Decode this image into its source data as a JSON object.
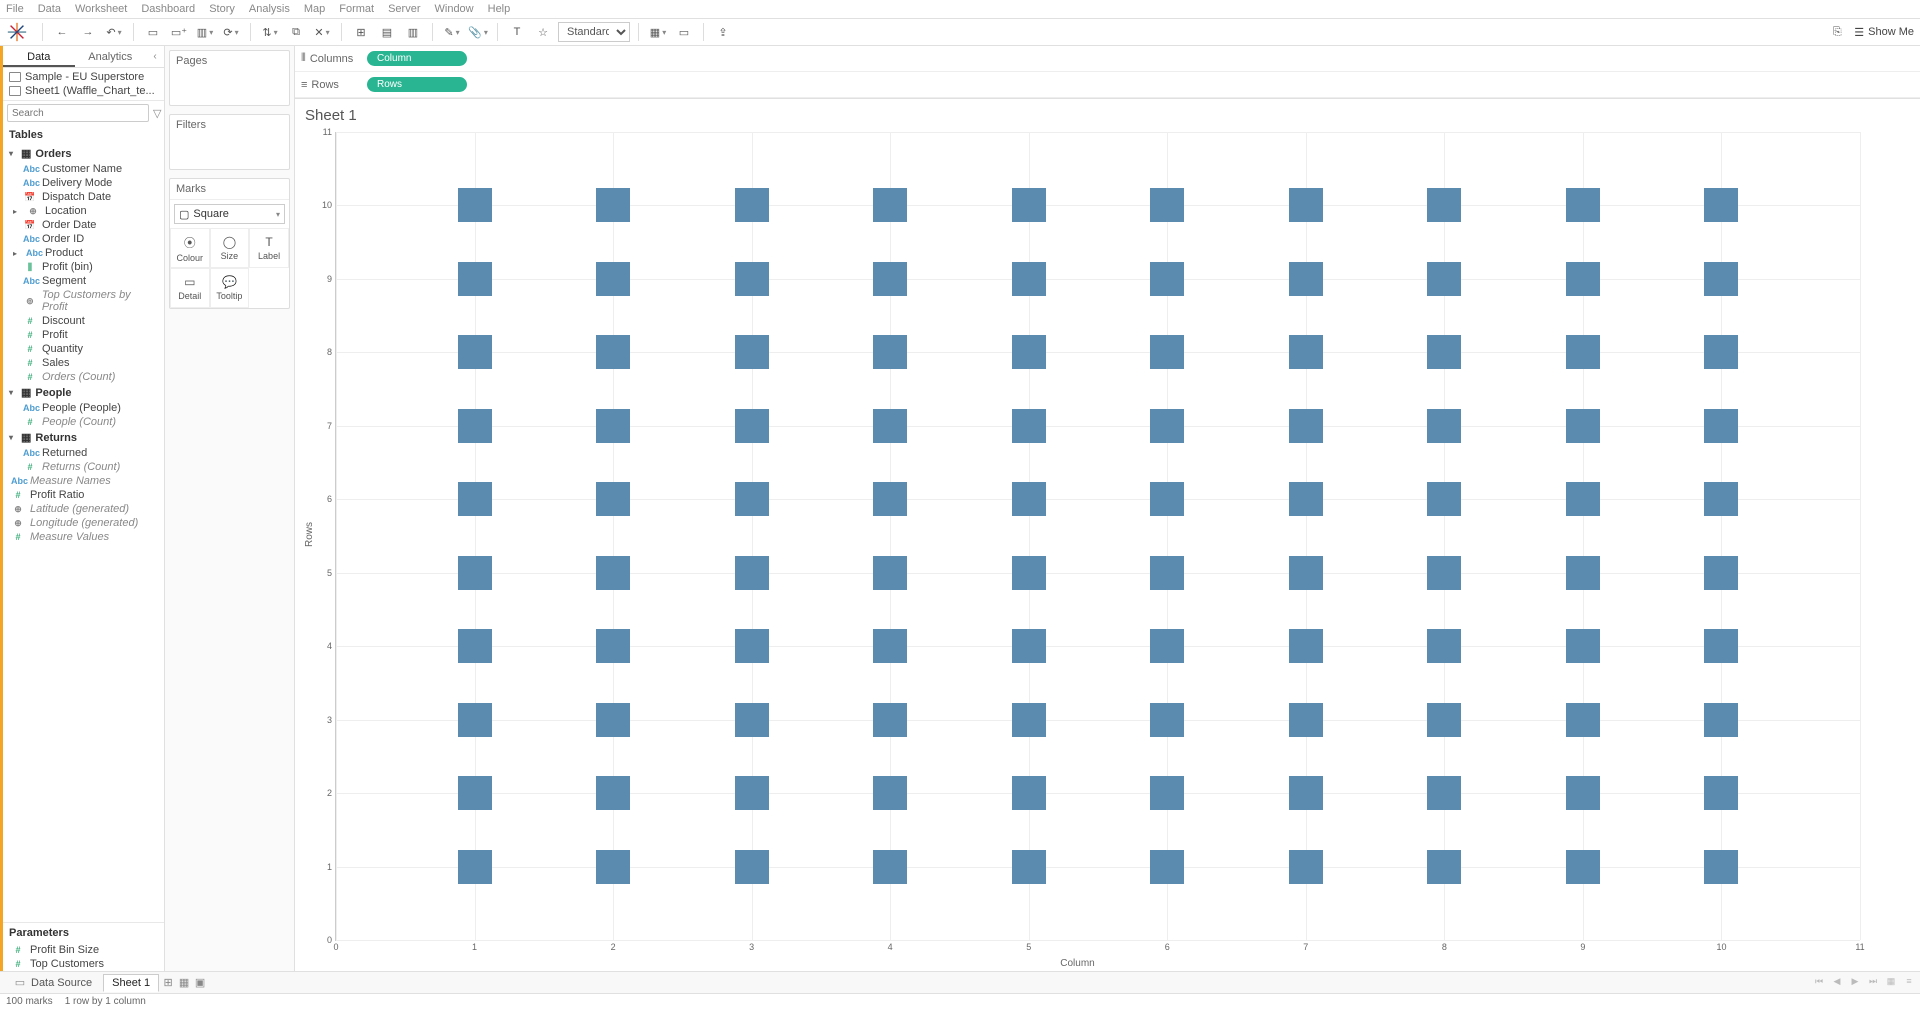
{
  "menu": [
    "File",
    "Data",
    "Worksheet",
    "Dashboard",
    "Story",
    "Analysis",
    "Map",
    "Format",
    "Server",
    "Window",
    "Help"
  ],
  "toolbar": {
    "fit": "Standard",
    "showme": "Show Me"
  },
  "side_tabs": {
    "data": "Data",
    "analytics": "Analytics"
  },
  "data_sources": [
    "Sample - EU Superstore",
    "Sheet1 (Waffle_Chart_te..."
  ],
  "search": {
    "placeholder": "Search"
  },
  "tables_header": "Tables",
  "tree": {
    "orders": {
      "label": "Orders",
      "fields": [
        {
          "ico": "abc",
          "label": "Customer Name"
        },
        {
          "ico": "abc",
          "label": "Delivery Mode"
        },
        {
          "ico": "date",
          "label": "Dispatch Date"
        },
        {
          "ico": "geo",
          "label": "Location",
          "expandable": true
        },
        {
          "ico": "date",
          "label": "Order Date"
        },
        {
          "ico": "abc",
          "label": "Order ID"
        },
        {
          "ico": "abc",
          "label": "Product",
          "expandable": true
        },
        {
          "ico": "bin",
          "label": "Profit (bin)"
        },
        {
          "ico": "abc",
          "label": "Segment"
        },
        {
          "ico": "set",
          "label": "Top Customers by Profit",
          "italic": true
        },
        {
          "ico": "num",
          "label": "Discount"
        },
        {
          "ico": "num",
          "label": "Profit"
        },
        {
          "ico": "num",
          "label": "Quantity"
        },
        {
          "ico": "num",
          "label": "Sales"
        },
        {
          "ico": "num",
          "label": "Orders (Count)",
          "italic": true
        }
      ]
    },
    "people": {
      "label": "People",
      "fields": [
        {
          "ico": "abc",
          "label": "People (People)"
        },
        {
          "ico": "num",
          "label": "People (Count)",
          "italic": true
        }
      ]
    },
    "returns": {
      "label": "Returns",
      "fields": [
        {
          "ico": "abc",
          "label": "Returned"
        },
        {
          "ico": "num",
          "label": "Returns (Count)",
          "italic": true
        }
      ]
    },
    "misc": [
      {
        "ico": "abc",
        "label": "Measure Names",
        "italic": true
      },
      {
        "ico": "num",
        "label": "Profit Ratio"
      },
      {
        "ico": "geo",
        "label": "Latitude (generated)",
        "italic": true
      },
      {
        "ico": "geo",
        "label": "Longitude (generated)",
        "italic": true
      },
      {
        "ico": "num",
        "label": "Measure Values",
        "italic": true
      }
    ]
  },
  "parameters": {
    "header": "Parameters",
    "items": [
      "Profit Bin Size",
      "Top Customers"
    ]
  },
  "shelves": {
    "pages": "Pages",
    "filters": "Filters",
    "marks": "Marks",
    "mark_type": "Square",
    "mark_btns": [
      "Colour",
      "Size",
      "Label",
      "Detail",
      "Tooltip"
    ]
  },
  "rowcol": {
    "columns_label": "Columns",
    "rows_label": "Rows",
    "columns_pill": "Column",
    "rows_pill": "Rows"
  },
  "sheet_title": "Sheet 1",
  "chart_data": {
    "type": "scatter",
    "xlabel": "Column",
    "ylabel": "Rows",
    "xlim": [
      0,
      11
    ],
    "ylim": [
      0,
      11
    ],
    "x_ticks": [
      0,
      1,
      2,
      3,
      4,
      5,
      6,
      7,
      8,
      9,
      10,
      11
    ],
    "y_ticks": [
      0,
      1,
      2,
      3,
      4,
      5,
      6,
      7,
      8,
      9,
      10,
      11
    ],
    "x": [
      1,
      2,
      3,
      4,
      5,
      6,
      7,
      8,
      9,
      10
    ],
    "y": [
      1,
      2,
      3,
      4,
      5,
      6,
      7,
      8,
      9,
      10
    ],
    "mark": "square",
    "note": "10x10 grid of square marks (waffle template)"
  },
  "bottom_tabs": {
    "data_source": "Data Source",
    "sheet": "Sheet 1"
  },
  "status": {
    "marks": "100 marks",
    "dims": "1 row by 1 column"
  }
}
